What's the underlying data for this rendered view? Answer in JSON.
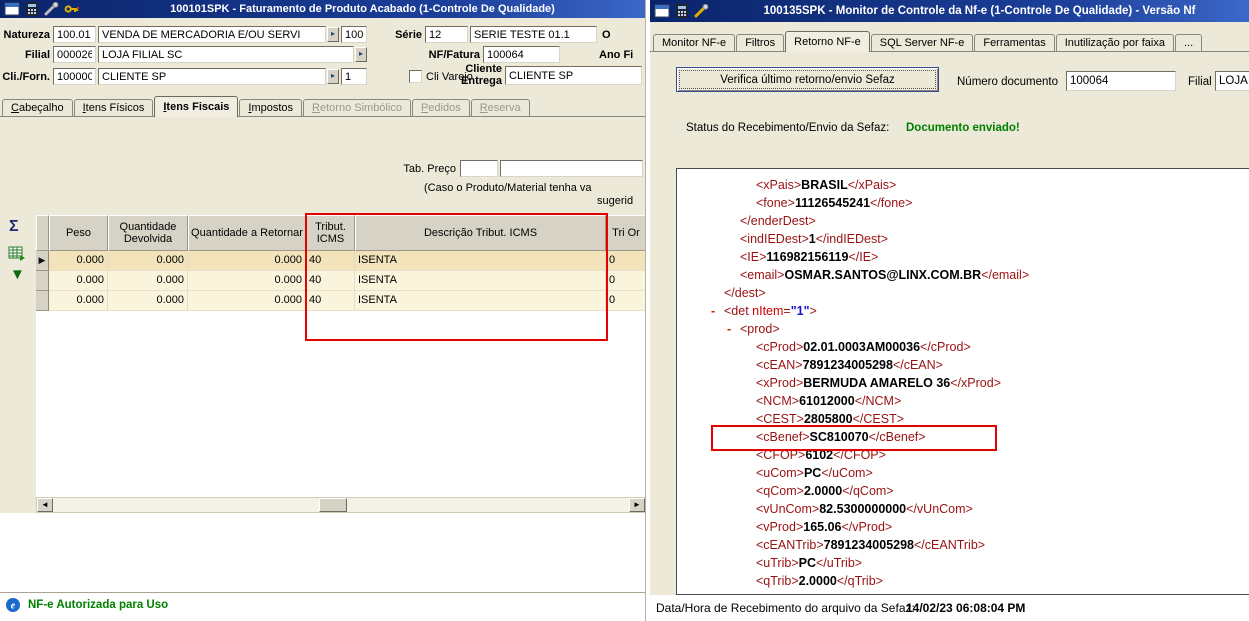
{
  "colors": {
    "titlebar_blue": "#0a246a",
    "status_green": "#008000",
    "annotation_red": "#e60000",
    "xml_tag_maroon": "#991111",
    "selected_row_cream": "#F2E3BA",
    "panel_tan": "#ECE9D8"
  },
  "left_window": {
    "title": "100101SPK - Faturamento de Produto Acabado (1-Controle De Qualidade)",
    "form": {
      "natureza": {
        "label": "Natureza",
        "code": "100.01",
        "desc": "VENDA DE MERCADORIA E/OU SERVI",
        "extra": "100"
      },
      "serie": {
        "label": "Série",
        "code": "12",
        "desc": "SERIE TESTE 01.1",
        "extra_label": "O"
      },
      "filial": {
        "label": "Filial",
        "code": "000026",
        "desc": "LOJA FILIAL SC"
      },
      "nf_fatura": {
        "label": "NF/Fatura",
        "value": "100064"
      },
      "ano_fiscal": {
        "label": "Ano Fi"
      },
      "cli_forn": {
        "label": "Cli./Forn.",
        "code": "100000",
        "desc": "CLIENTE SP",
        "qty": "1"
      },
      "cli_varejo": {
        "label": "Cli Varejo",
        "checked": false
      },
      "cliente_entrega": {
        "label_line1": "Cliente",
        "label_line2": "Entrega",
        "value": "CLIENTE SP"
      },
      "tab_preco": {
        "label": "Tab. Preço",
        "field1": "",
        "field2": ""
      },
      "note_line1": "(Caso o Produto/Material tenha va",
      "note_line2": "sugerid"
    },
    "tabs": [
      {
        "label": "Cabeçalho",
        "state": "normal"
      },
      {
        "label": "Itens Físicos",
        "state": "normal"
      },
      {
        "label": "Itens Fiscais",
        "state": "active"
      },
      {
        "label": "Impostos",
        "state": "normal"
      },
      {
        "label": "Retorno Simbólico",
        "state": "disabled"
      },
      {
        "label": "Pedidos",
        "state": "disabled"
      },
      {
        "label": "Reserva",
        "state": "disabled"
      }
    ],
    "grid": {
      "columns": [
        "",
        "Peso",
        "Quantidade Devolvida",
        "Quantidade a Retornar",
        "Tribut. ICMS",
        "Descrição Tribut. ICMS",
        "Tri Or"
      ],
      "rows": [
        {
          "selected": true,
          "cells": [
            "0.000",
            "0.000",
            "0.000",
            "40",
            "ISENTA",
            "0"
          ]
        },
        {
          "selected": false,
          "cells": [
            "0.000",
            "0.000",
            "0.000",
            "40",
            "ISENTA",
            "0"
          ]
        },
        {
          "selected": false,
          "cells": [
            "0.000",
            "0.000",
            "0.000",
            "40",
            "ISENTA",
            "0"
          ]
        }
      ]
    },
    "status_text": "NF-e Autorizada para Uso"
  },
  "right_window": {
    "title": "100135SPK - Monitor de Controle da Nf-e (1-Controle De Qualidade) - Versão Nf",
    "tabs": [
      {
        "label": "Monitor NF-e",
        "state": "normal"
      },
      {
        "label": "Filtros",
        "state": "normal"
      },
      {
        "label": "Retorno NF-e",
        "state": "active"
      },
      {
        "label": "SQL Server NF-e",
        "state": "normal"
      },
      {
        "label": "Ferramentas",
        "state": "normal"
      },
      {
        "label": "Inutilização por faixa",
        "state": "normal"
      },
      {
        "label": "...",
        "state": "normal"
      }
    ],
    "verify_button": "Verifica último retorno/envio Sefaz",
    "numero_documento": {
      "label": "Número documento",
      "value": "100064"
    },
    "filial": {
      "label": "Filial",
      "value": "LOJA FILIA"
    },
    "sefaz_status": {
      "label": "Status do Recebimento/Envio da Sefaz:",
      "value": "Documento enviado!"
    },
    "xml": {
      "lines": [
        {
          "indent": 3,
          "tag": "xPais",
          "value": "BRASIL"
        },
        {
          "indent": 3,
          "tag": "fone",
          "value": "11126545241"
        },
        {
          "indent": 2,
          "close": "enderDest"
        },
        {
          "indent": 2,
          "tag": "indIEDest",
          "value": "1"
        },
        {
          "indent": 2,
          "tag": "IE",
          "value": "116982156119"
        },
        {
          "indent": 2,
          "tag": "email",
          "value": "OSMAR.SANTOS@LINX.COM.BR"
        },
        {
          "indent": 1,
          "close": "dest"
        },
        {
          "indent": 1,
          "marker": "-",
          "open": "det",
          "attr": {
            "name": "nItem",
            "value": "1"
          }
        },
        {
          "indent": 2,
          "marker": "-",
          "open": "prod"
        },
        {
          "indent": 3,
          "tag": "cProd",
          "value": "02.01.0003AM00036"
        },
        {
          "indent": 3,
          "tag": "cEAN",
          "value": "7891234005298"
        },
        {
          "indent": 3,
          "tag": "xProd",
          "value": "BERMUDA AMARELO 36"
        },
        {
          "indent": 3,
          "tag": "NCM",
          "value": "61012000"
        },
        {
          "indent": 3,
          "tag": "CEST",
          "value": "2805800"
        },
        {
          "indent": 3,
          "tag": "cBenef",
          "value": "SC810070",
          "highlighted": true
        },
        {
          "indent": 3,
          "tag": "CFOP",
          "value": "6102"
        },
        {
          "indent": 3,
          "tag": "uCom",
          "value": "PC"
        },
        {
          "indent": 3,
          "tag": "qCom",
          "value": "2.0000"
        },
        {
          "indent": 3,
          "tag": "vUnCom",
          "value": "82.5300000000"
        },
        {
          "indent": 3,
          "tag": "vProd",
          "value": "165.06"
        },
        {
          "indent": 3,
          "tag": "cEANTrib",
          "value": "7891234005298"
        },
        {
          "indent": 3,
          "tag": "uTrib",
          "value": "PC"
        },
        {
          "indent": 3,
          "tag": "qTrib",
          "value": "2.0000"
        }
      ]
    },
    "footer": {
      "label": "Data/Hora de Recebimento do arquivo da Sefaz:",
      "value": "14/02/23 06:08:04 PM"
    }
  }
}
